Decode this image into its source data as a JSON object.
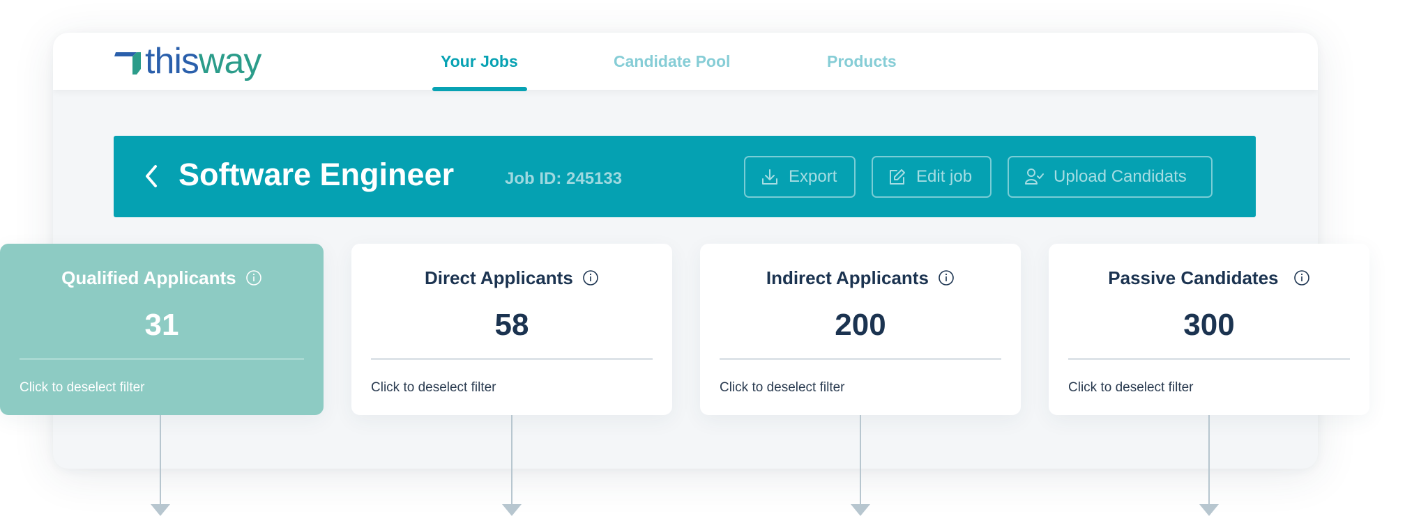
{
  "brand": {
    "logo_part1": "this",
    "logo_part2": "way",
    "colors": {
      "blue": "#2a5fab",
      "green": "#2b9c8a",
      "accent": "#05a1b2"
    }
  },
  "nav": {
    "items": [
      {
        "label": "Your Jobs",
        "active": true
      },
      {
        "label": "Candidate Pool",
        "active": false
      },
      {
        "label": "Products",
        "active": false
      }
    ]
  },
  "job": {
    "back_icon": "chevron-left-icon",
    "title": "Software Engineer",
    "id_label": "Job ID: 245133",
    "actions": [
      {
        "label": "Export",
        "icon": "download-icon"
      },
      {
        "label": "Edit job",
        "icon": "edit-icon"
      },
      {
        "label": "Upload Candidats",
        "icon": "user-check-icon"
      }
    ]
  },
  "cards": [
    {
      "title": "Qualified Applicants",
      "value": "31",
      "footer": "Click to deselect filter",
      "selected": true
    },
    {
      "title": "Direct Applicants",
      "value": "58",
      "footer": "Click to deselect filter",
      "selected": false
    },
    {
      "title": "Indirect Applicants",
      "value": "200",
      "footer": "Click to deselect filter",
      "selected": false
    },
    {
      "title": "Passive Candidates",
      "value": "300",
      "footer": "Click to deselect filter",
      "selected": false
    }
  ]
}
